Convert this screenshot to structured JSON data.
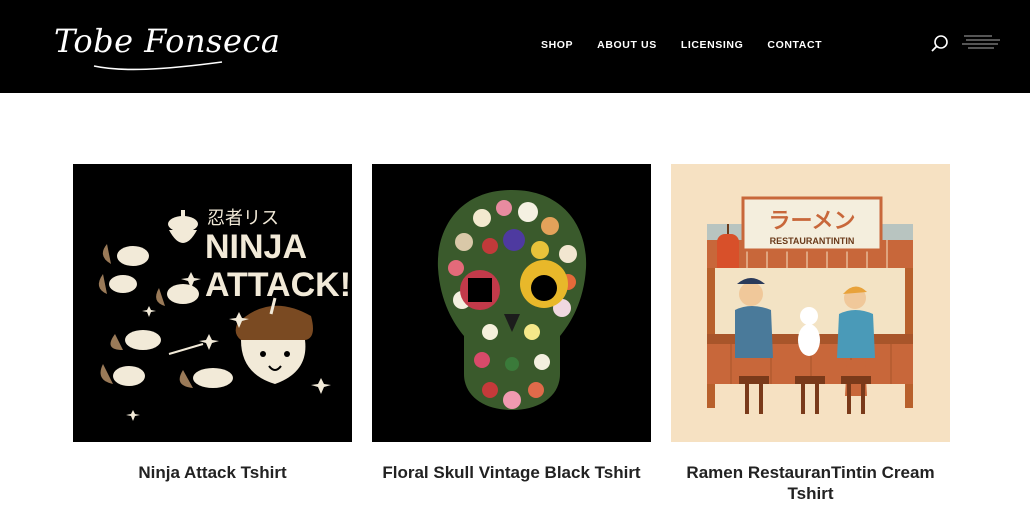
{
  "header": {
    "logo_text": "Tobe Fonseca",
    "nav": [
      "SHOP",
      "ABOUT US",
      "LICENSING",
      "CONTACT"
    ]
  },
  "products": [
    {
      "title": "Ninja Attack Tshirt",
      "art_jp": "忍者リス",
      "art_line1": "NINJA",
      "art_line2": "ATTACK!",
      "bg": "#000000"
    },
    {
      "title": "Floral Skull Vintage Black Tshirt",
      "bg": "#000000"
    },
    {
      "title": "Ramen RestauranTintin Cream Tshirt",
      "art_jp": "ラーメン",
      "art_sign": "RESTAURANTINTIN",
      "bg": "#f6e1c2"
    }
  ],
  "colors": {
    "header_bg": "#000000",
    "text": "#222222",
    "cream": "#f6e1c2"
  }
}
